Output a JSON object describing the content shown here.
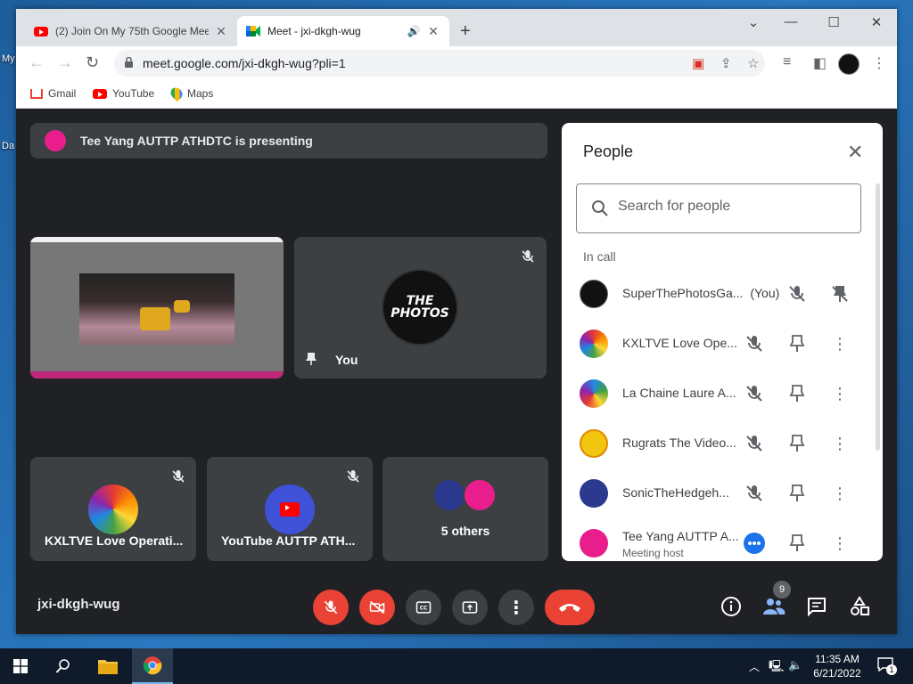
{
  "browser": {
    "tabs": [
      {
        "label": "(2) Join On My 75th Google Meet",
        "icon": "youtube-icon"
      },
      {
        "label": "Meet - jxi-dkgh-wug",
        "icon": "meet-icon"
      }
    ],
    "url": "meet.google.com/jxi-dkgh-wug?pli=1",
    "bookmarks": [
      "Gmail",
      "YouTube",
      "Maps"
    ]
  },
  "desktop": {
    "labels": [
      "My",
      "Da"
    ]
  },
  "meet": {
    "presenting_text": "Tee Yang AUTTP ATHDTC is presenting",
    "you_tile_label": "You",
    "photos_avatar_text": [
      "THE",
      "PHOTOS"
    ],
    "tiles": [
      {
        "name": "KXLTVE Love Operati..."
      },
      {
        "name": "YouTube AUTTP ATH..."
      },
      {
        "name": "5 others"
      }
    ],
    "meeting_code": "jxi-dkgh-wug",
    "participant_count": "9"
  },
  "people": {
    "title": "People",
    "search_placeholder": "Search for people",
    "section_label": "In call",
    "participants": [
      {
        "name": "SuperThePhotosGa...",
        "suffix": "(You)",
        "sub": ""
      },
      {
        "name": "KXLTVE Love Ope...",
        "suffix": "",
        "sub": ""
      },
      {
        "name": "La Chaine Laure A...",
        "suffix": "",
        "sub": ""
      },
      {
        "name": "Rugrats The Video...",
        "suffix": "",
        "sub": ""
      },
      {
        "name": "SonicTheHedgeh...",
        "suffix": "",
        "sub": ""
      },
      {
        "name": "Tee Yang AUTTP A...",
        "suffix": "",
        "sub": "Meeting host"
      }
    ]
  },
  "taskbar": {
    "time": "11:35 AM",
    "date": "6/21/2022",
    "notification_count": "1"
  },
  "colors": {
    "meet_bg": "#202124",
    "tile_bg": "#3c4043",
    "danger": "#ea4335",
    "accent_blue": "#1a73e8"
  }
}
